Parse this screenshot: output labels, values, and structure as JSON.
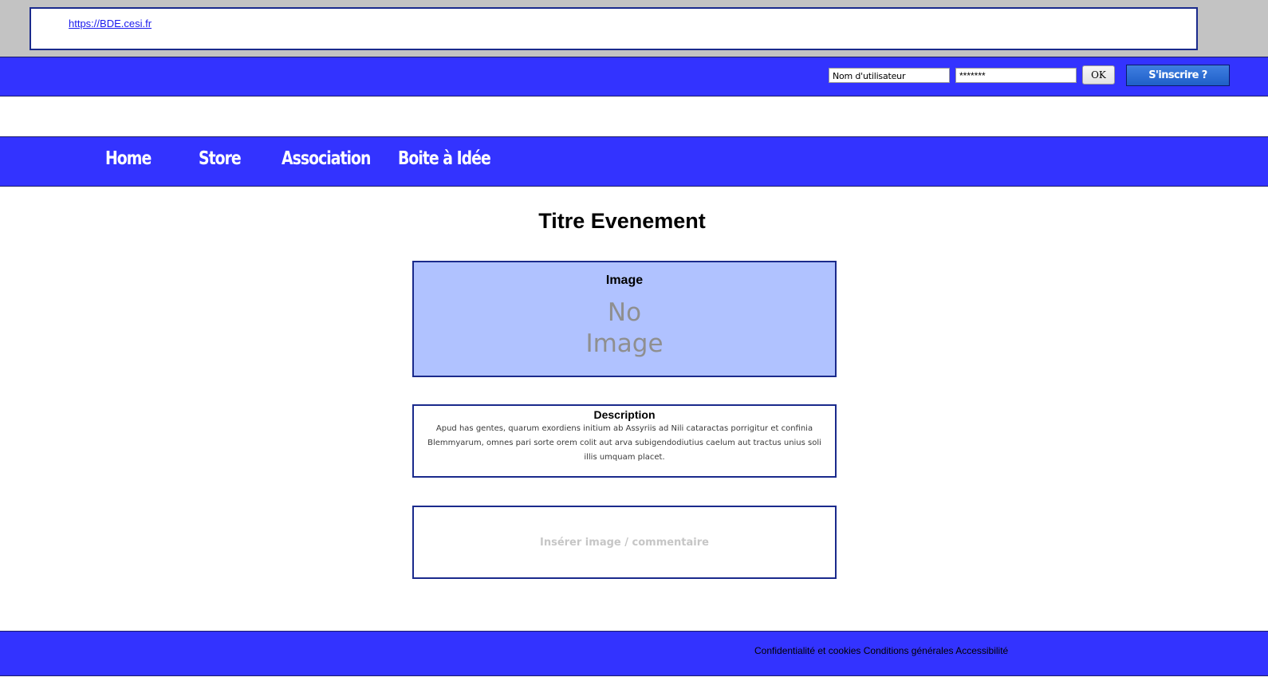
{
  "address_bar": {
    "url": "https://BDE.cesi.fr"
  },
  "login": {
    "username_value": "Nom d'utilisateur",
    "password_value": "*******",
    "ok_label": "OK",
    "signup_label": "S'inscrire ?"
  },
  "nav": {
    "items": [
      {
        "label": "Home"
      },
      {
        "label": "Store"
      },
      {
        "label": "Association"
      },
      {
        "label": "Boite à Idée"
      }
    ]
  },
  "event": {
    "title": "Titre Evenement",
    "image_label": "Image",
    "no_image_line1": "No",
    "no_image_line2": "Image",
    "description_label": "Description",
    "description_text": "Apud has gentes, quarum exordiens initium ab Assyriis ad Nili cataractas porrigitur et confinia Blemmyarum, omnes pari sorte orem colit aut arva subigendodiutius caelum aut tractus unius soli illis umquam placet.",
    "insert_placeholder": "Insérer image / commentaire"
  },
  "footer": {
    "links": [
      {
        "label": "Confidentialité et cookies"
      },
      {
        "label": "Conditions générales"
      },
      {
        "label": "Accessibilité"
      }
    ]
  },
  "colors": {
    "brand_blue": "#3333ff",
    "image_panel_bg": "#b0c2ff",
    "border_navy": "#1a2a8c",
    "top_gray": "#c3c3c3"
  }
}
